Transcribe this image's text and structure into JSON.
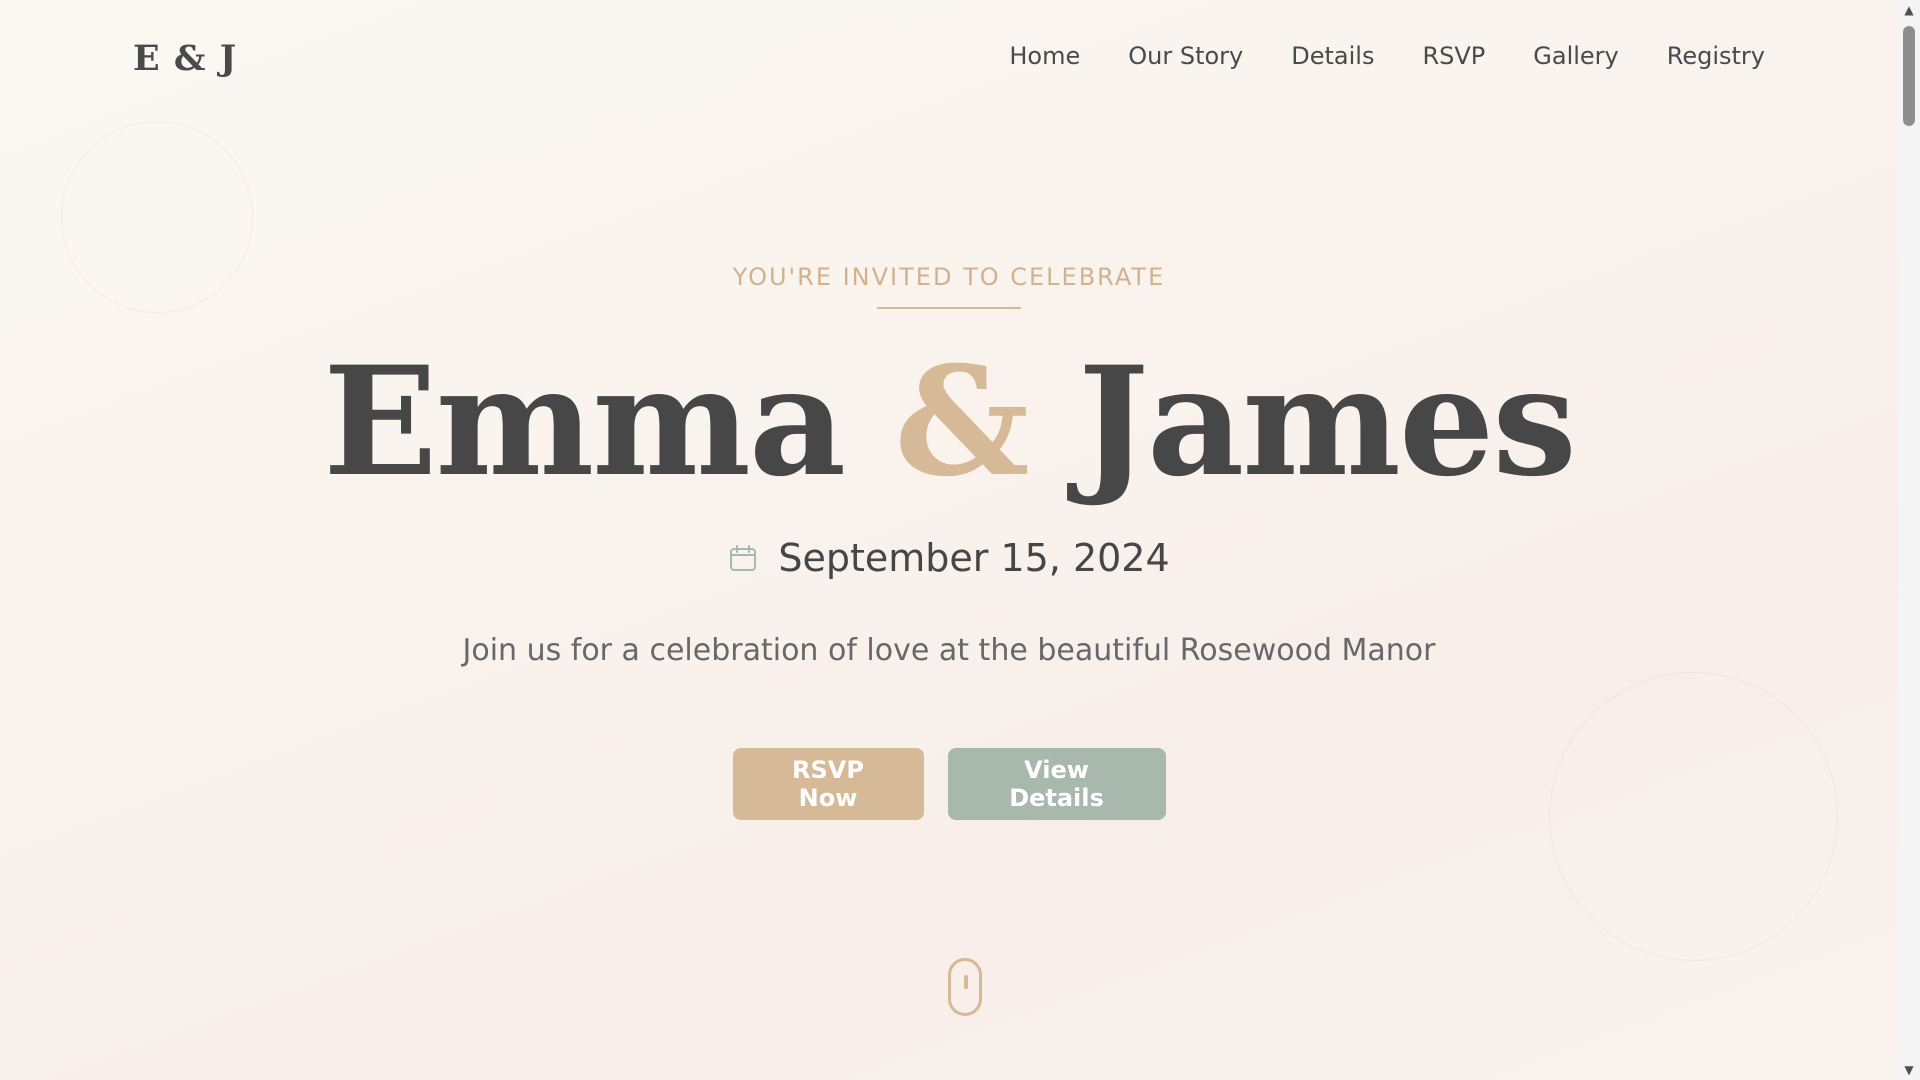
{
  "header": {
    "logo": "E & J",
    "nav": [
      {
        "label": "Home"
      },
      {
        "label": "Our Story"
      },
      {
        "label": "Details"
      },
      {
        "label": "RSVP"
      },
      {
        "label": "Gallery"
      },
      {
        "label": "Registry"
      }
    ]
  },
  "hero": {
    "eyebrow": "YOU'RE INVITED TO CELEBRATE",
    "name_one": "Emma",
    "ampersand": "&",
    "name_two": "James",
    "date_icon": "calendar-icon",
    "date": "September 15, 2024",
    "tagline": "Join us for a celebration of love at the beautiful Rosewood Manor",
    "buttons": {
      "primary": "RSVP Now",
      "secondary": "View Details"
    },
    "scroll_indicator_icon": "mouse-scroll-icon"
  },
  "colors": {
    "accent_gold": "#d6b996",
    "accent_sage": "#a8b8ac",
    "text_dark": "#474747",
    "text_muted": "#686868"
  },
  "scrollbar": {
    "up_icon": "▲",
    "down_icon": "▼"
  }
}
